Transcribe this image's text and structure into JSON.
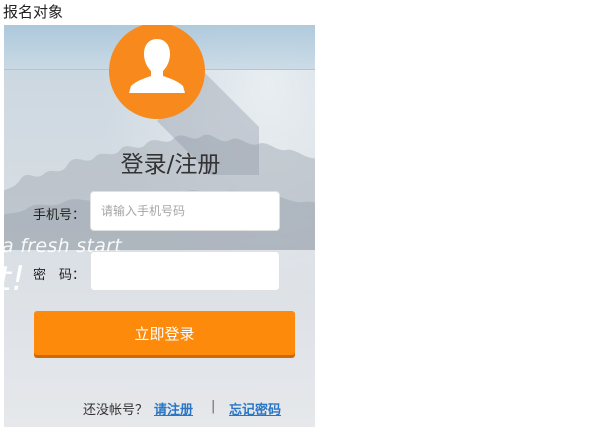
{
  "page_label": "报名对象",
  "background": {
    "overlay_text": "a fresh start",
    "overlay_glyph": "t!"
  },
  "avatar": {
    "icon": "user-silhouette-icon",
    "color": "#f7891d"
  },
  "form": {
    "title": "登录/注册",
    "phone": {
      "label": "手机号：",
      "placeholder": "请输入手机号码",
      "value": ""
    },
    "password": {
      "label": "密　码：",
      "value": ""
    },
    "submit_label": "立即登录",
    "submit_color": "#fe8a0b"
  },
  "footer": {
    "question": "还没帐号？",
    "register_link": "请注册",
    "separator": "|",
    "forgot_link": "忘记密码",
    "link_color": "#2a76c6"
  }
}
